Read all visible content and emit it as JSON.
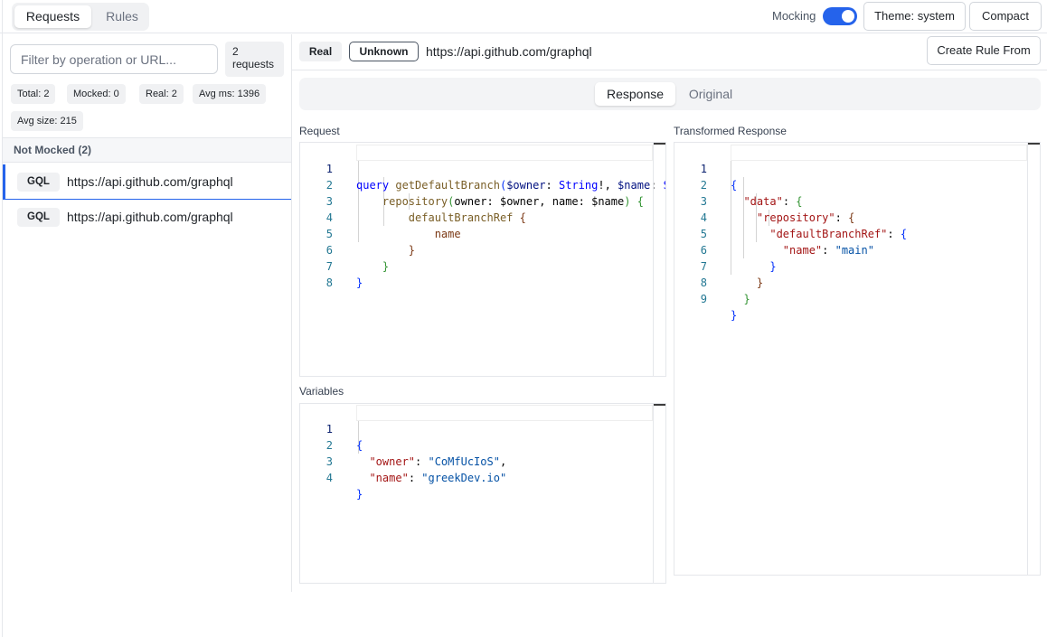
{
  "top_bar": {
    "tabs": [
      {
        "label": "Requests",
        "active": true
      },
      {
        "label": "Rules",
        "active": false
      }
    ],
    "mocking_label": "Mocking",
    "mocking_enabled": true,
    "theme_button": "Theme: system",
    "compact_button": "Compact"
  },
  "sidebar": {
    "filter_placeholder": "Filter by operation or URL...",
    "count_number": "2",
    "count_unit": "requests",
    "stats": {
      "total": "Total: 2",
      "mocked": "Mocked: 0",
      "real": "Real: 2",
      "avg_ms": "Avg ms: 1396",
      "avg_size": "Avg size: 215"
    },
    "group_header": "Not Mocked (2)",
    "requests": [
      {
        "type": "GQL",
        "url": "https://api.github.com/graphql",
        "selected": true
      },
      {
        "type": "GQL",
        "url": "https://api.github.com/graphql",
        "selected": false
      }
    ]
  },
  "detail": {
    "source_badge": "Real",
    "status_badge": "Unknown",
    "url": "https://api.github.com/graphql",
    "create_rule_button": "Create Rule From",
    "tabs": [
      {
        "label": "Response",
        "active": true
      },
      {
        "label": "Original",
        "active": false
      }
    ],
    "request_label": "Request",
    "variables_label": "Variables",
    "transformed_label": "Transformed Response",
    "request_code": {
      "line_numbers": [
        "1",
        "2",
        "3",
        "4",
        "5",
        "6",
        "7",
        "8"
      ],
      "l1_kw": "query",
      "l1_fn": "getDefaultBranch",
      "l1_p1": "(",
      "l1_var1": "$owner",
      "l1_c1": ": ",
      "l1_ty1": "String",
      "l1_bang": "!, ",
      "l1_var2": "$name",
      "l1_c2": ": ",
      "l1_ty2": "S",
      "l2_fn": "repository",
      "l2_p1": "(",
      "l2_t1": "owner: $owner, name: $name",
      "l2_p2": ")",
      "l2_b": "{",
      "l3_fn": "defaultBranchRef",
      "l3_b": "{",
      "l4_t": "name",
      "l5_b": "}",
      "l6_b": "}",
      "l7_b": "}"
    },
    "variables_code": {
      "line_numbers": [
        "1",
        "2",
        "3",
        "4"
      ],
      "l1": "{",
      "l2_key": "\"owner\"",
      "l2_sep": ": ",
      "l2_val": "\"CoMfUcIoS\"",
      "l2_end": ",",
      "l3_key": "\"name\"",
      "l3_sep": ": ",
      "l3_val": "\"greekDev.io\"",
      "l4": "}"
    },
    "response_code": {
      "line_numbers": [
        "1",
        "2",
        "3",
        "4",
        "5",
        "6",
        "7",
        "8",
        "9"
      ],
      "l1": "{",
      "l2_key": "\"data\"",
      "l2_sep": ": ",
      "l2_b": "{",
      "l3_key": "\"repository\"",
      "l3_sep": ": ",
      "l3_b": "{",
      "l4_key": "\"defaultBranchRef\"",
      "l4_sep": ": ",
      "l4_b": "{",
      "l5_key": "\"name\"",
      "l5_sep": ": ",
      "l5_val": "\"main\"",
      "l6": "}",
      "l7": "}",
      "l8": "}",
      "l9": "}"
    }
  },
  "colors": {
    "accent": "#2563eb",
    "line_number": "#237893",
    "keyword": "#0000ff",
    "function": "#795e26",
    "json_key": "#a31515",
    "json_string": "#0451a5"
  }
}
